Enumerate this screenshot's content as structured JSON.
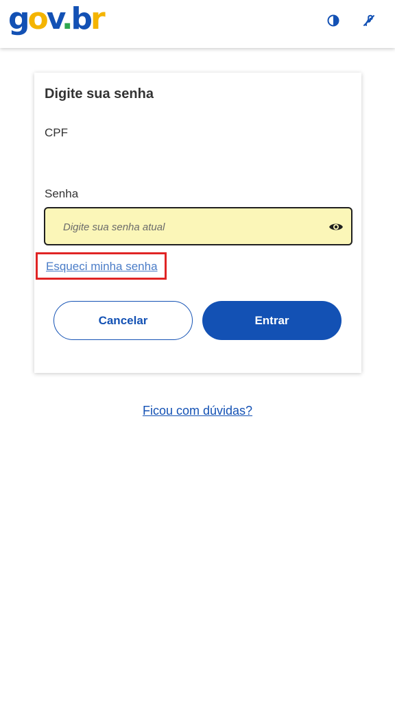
{
  "header": {
    "logo": {
      "part1": "g",
      "part2": "o",
      "part3": "v",
      "part4": ".",
      "part5": "b",
      "part6": "r"
    },
    "icons": {
      "contrast": "contrast-icon",
      "accessibility": "sign-language-icon"
    }
  },
  "login": {
    "title": "Digite sua senha",
    "cpf_label": "CPF",
    "password_label": "Senha",
    "password_placeholder": "Digite sua senha atual",
    "password_value": "",
    "eye_icon": "eye-icon",
    "forgot_password": "Esqueci minha senha",
    "cancel_label": "Cancelar",
    "enter_label": "Entrar"
  },
  "footer": {
    "doubts_link": "Ficou com dúvidas?"
  },
  "colors": {
    "brand_blue": "#1351b4",
    "brand_green": "#2fa84f",
    "brand_yellow": "#f4b400",
    "input_bg": "#fbf6b8",
    "highlight_red": "#e02424"
  }
}
